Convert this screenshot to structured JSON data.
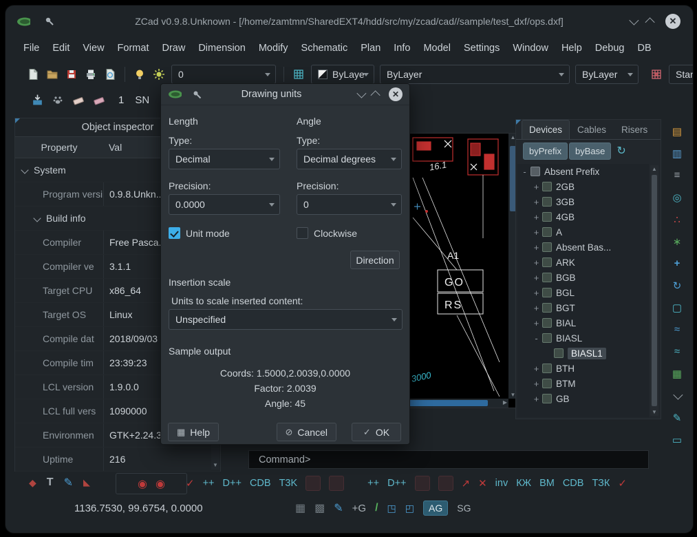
{
  "window": {
    "title": "ZCad v0.9.8.Unknown - [/home/zamtmn/SharedEXT4/hdd/src/my/zcad/cad//sample/test_dxf/ops.dxf]"
  },
  "menu": {
    "items": [
      "File",
      "Edit",
      "View",
      "Format",
      "Draw",
      "Dimension",
      "Modify",
      "Schematic",
      "Plan",
      "Info",
      "Model",
      "Settings",
      "Window",
      "Help",
      "Debug",
      "DB"
    ]
  },
  "toolbar": {
    "layer": "0",
    "color": "ByLaye",
    "linetype": "ByLayer",
    "lineweight": "ByLayer",
    "style": "Standa",
    "scale": "1",
    "sn": "SN"
  },
  "inspector": {
    "title": "Object inspector",
    "col_property": "Property",
    "col_value": "Val",
    "rows": [
      {
        "label": "System",
        "value": ""
      },
      {
        "label": "Program versi",
        "value": "0.9.8.Unkn..."
      },
      {
        "label": "Build info",
        "value": ""
      },
      {
        "label": "Compiler",
        "value": "Free Pasca..."
      },
      {
        "label": "Compiler ve",
        "value": "3.1.1"
      },
      {
        "label": "Target CPU",
        "value": "x86_64"
      },
      {
        "label": "Target OS",
        "value": "Linux"
      },
      {
        "label": "Compile dat",
        "value": "2018/09/03"
      },
      {
        "label": "Compile tim",
        "value": "23:39:23"
      },
      {
        "label": "LCL version",
        "value": "1.9.0.0"
      },
      {
        "label": "LCL full vers",
        "value": "1090000"
      },
      {
        "label": "Environmen",
        "value": "GTK+2.24.3..."
      },
      {
        "label": "Uptime",
        "value": "216"
      }
    ]
  },
  "canvas": {
    "labels": {
      "dim": "16.1",
      "a1": "A1",
      "go": "GO",
      "rs": "RS",
      "len": "3000"
    }
  },
  "dialog": {
    "title": "Drawing units",
    "length_heading": "Length",
    "angle_heading": "Angle",
    "type_label": "Type:",
    "precision_label": "Precision:",
    "length_type": "Decimal",
    "length_precision": "0.0000",
    "angle_type": "Decimal degrees",
    "angle_precision": "0",
    "unit_mode": "Unit mode",
    "clockwise": "Clockwise",
    "direction": "Direction",
    "insertion_heading": "Insertion scale",
    "insertion_label": "Units to scale inserted content:",
    "insertion_value": "Unspecified",
    "sample_heading": "Sample output",
    "sample_coords": "Coords: 1.5000,2.0039,0.0000",
    "sample_factor": "Factor: 2.0039",
    "sample_angle": "Angle: 45",
    "help": "Help",
    "cancel": "Cancel",
    "ok": "OK"
  },
  "devices": {
    "tabs": [
      "Devices",
      "Cables",
      "Risers"
    ],
    "by_prefix": "byPrefix",
    "by_base": "byBase",
    "tree": [
      {
        "label": "Absent Prefix",
        "exp": "-"
      },
      {
        "label": "2GB",
        "exp": "+"
      },
      {
        "label": "3GB",
        "exp": "+"
      },
      {
        "label": "4GB",
        "exp": "+"
      },
      {
        "label": "A",
        "exp": "+"
      },
      {
        "label": "Absent Bas...",
        "exp": "+"
      },
      {
        "label": "ARK",
        "exp": "+"
      },
      {
        "label": "BGB",
        "exp": "+"
      },
      {
        "label": "BGL",
        "exp": "+"
      },
      {
        "label": "BGT",
        "exp": "+"
      },
      {
        "label": "BIAL",
        "exp": "+"
      },
      {
        "label": "BIASL",
        "exp": "-"
      },
      {
        "label": "BIASL1",
        "exp": ""
      },
      {
        "label": "BTH",
        "exp": "+"
      },
      {
        "label": "BTM",
        "exp": "+"
      },
      {
        "label": "GB",
        "exp": "+"
      }
    ]
  },
  "command": {
    "prompt": "Command>"
  },
  "bottom": {
    "g1": [
      "++",
      "D++",
      "CDB",
      "T3K"
    ],
    "g2": [
      "++",
      "D++"
    ],
    "g3": [
      "inv",
      "КЖ",
      "ВМ",
      "CDB",
      "ТЗК"
    ]
  },
  "status": {
    "coords": "1136.7530, 99.6754, 0.0000",
    "plus_g": "+G",
    "ag": "AG",
    "sg": "SG"
  }
}
